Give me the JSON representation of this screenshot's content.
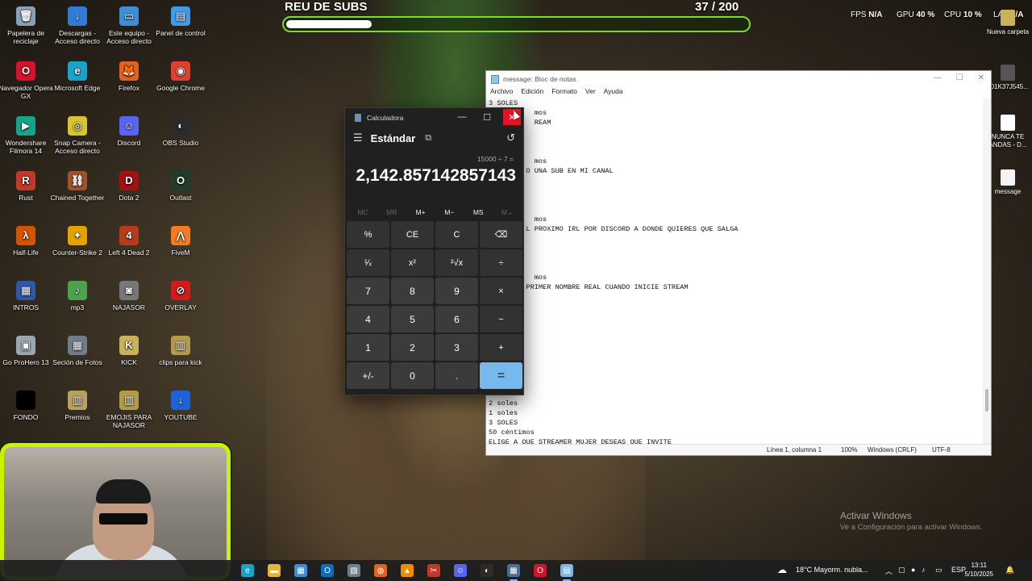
{
  "overlay": {
    "title": "REU DE SUBS",
    "count": "37 / 200",
    "progress": 0.185,
    "stats": {
      "fps_label": "FPS",
      "fps_value": "N/A",
      "gpu_label": "GPU",
      "gpu_value": "40 %",
      "cpu_label": "CPU",
      "cpu_value": "10 %",
      "lat_label": "LAT",
      "lat_value": "N/A"
    }
  },
  "desktop_icons": [
    {
      "label": "Papelera de reciclaje",
      "icon": "recycle-bin-icon",
      "color": "#8aa0b6",
      "glyph": "🗑"
    },
    {
      "label": "Descargas - Acceso directo",
      "icon": "downloads-icon",
      "color": "#2f7bd6",
      "glyph": "↓"
    },
    {
      "label": "Este equipo - Acceso directo",
      "icon": "computer-icon",
      "color": "#3b8fd9",
      "glyph": "▭"
    },
    {
      "label": "Panel de control",
      "icon": "control-panel-icon",
      "color": "#3d9be9",
      "glyph": "▤"
    },
    {
      "label": "Navegador Opera GX",
      "icon": "opera-gx-icon",
      "color": "#d3122b",
      "glyph": "O"
    },
    {
      "label": "Microsoft Edge",
      "icon": "edge-icon",
      "color": "#1aa3c9",
      "glyph": "e"
    },
    {
      "label": "Firefox",
      "icon": "firefox-icon",
      "color": "#e8601c",
      "glyph": "🦊"
    },
    {
      "label": "Google Chrome",
      "icon": "chrome-icon",
      "color": "#e0402f",
      "glyph": "◉"
    },
    {
      "label": "Wondershare Filmora 14",
      "icon": "filmora-icon",
      "color": "#14a58b",
      "glyph": "▶"
    },
    {
      "label": "Snap Camera - Acceso directo",
      "icon": "snap-camera-icon",
      "color": "#d8c62c",
      "glyph": "◎"
    },
    {
      "label": "Discord",
      "icon": "discord-icon",
      "color": "#5865f2",
      "glyph": "☺"
    },
    {
      "label": "OBS Studio",
      "icon": "obs-icon",
      "color": "#2b2b2b",
      "glyph": "◐"
    },
    {
      "label": "Rust",
      "icon": "rust-icon",
      "color": "#c0392b",
      "glyph": "R"
    },
    {
      "label": "Chained Together",
      "icon": "chained-together-icon",
      "color": "#a0522d",
      "glyph": "⛓"
    },
    {
      "label": "Dota 2",
      "icon": "dota2-icon",
      "color": "#a31212",
      "glyph": "D"
    },
    {
      "label": "Outlast",
      "icon": "outlast-icon",
      "color": "#1e3d2a",
      "glyph": "O"
    },
    {
      "label": "Half-Life",
      "icon": "half-life-icon",
      "color": "#d35400",
      "glyph": "λ"
    },
    {
      "label": "Counter-Strike 2",
      "icon": "counter-strike-icon",
      "color": "#e3a300",
      "glyph": "✦"
    },
    {
      "label": "Left 4 Dead 2",
      "icon": "left4dead-icon",
      "color": "#b53b1a",
      "glyph": "4"
    },
    {
      "label": "FiveM",
      "icon": "fivem-icon",
      "color": "#f47b20",
      "glyph": "⋀"
    },
    {
      "label": "INTROS",
      "icon": "folder-icon",
      "color": "#3057a8",
      "glyph": "▦"
    },
    {
      "label": "mp3",
      "icon": "media-icon",
      "color": "#4da34d",
      "glyph": "♪"
    },
    {
      "label": "NAJASOR",
      "icon": "camera-icon",
      "color": "#777777",
      "glyph": "◙"
    },
    {
      "label": "OVERLAY",
      "icon": "overlay-icon",
      "color": "#d11b1b",
      "glyph": "⊘"
    },
    {
      "label": "Go ProHero 13",
      "icon": "gopro-icon",
      "color": "#9aa6b0",
      "glyph": "▣"
    },
    {
      "label": "Seción de Fotos",
      "icon": "photos-icon",
      "color": "#6e7f8a",
      "glyph": "▦"
    },
    {
      "label": "KICK",
      "icon": "kick-icon",
      "color": "#c9b25a",
      "glyph": "K"
    },
    {
      "label": "clips para kick",
      "icon": "clips-folder-icon",
      "color": "#b39b4a",
      "glyph": "▥"
    },
    {
      "label": "FONDO",
      "icon": "fondo-icon",
      "color": "#000000",
      "glyph": ""
    },
    {
      "label": "Premios",
      "icon": "premios-icon",
      "color": "#b8a060",
      "glyph": "▥"
    },
    {
      "label": "EMOJIS PARA NAJASOR",
      "icon": "emojis-folder-icon",
      "color": "#b39b4a",
      "glyph": "▥"
    },
    {
      "label": "YOUTUBE",
      "icon": "youtube-download-icon",
      "color": "#1e63d6",
      "glyph": "↓"
    }
  ],
  "right_icons": [
    {
      "label": "Nueva carpeta",
      "icon": "folder-icon"
    },
    {
      "label": "_01K37J545...",
      "icon": "image-file-icon"
    },
    {
      "label": "NUNCA TE ANDAS - D...",
      "icon": "video-file-icon"
    },
    {
      "label": "message",
      "icon": "text-file-icon"
    }
  ],
  "notepad": {
    "title": "message: Bloc de notas",
    "menu": [
      "Archivo",
      "Edición",
      "Formato",
      "Ver",
      "Ayuda"
    ],
    "lines_top": [
      "3 SOLES",
      "           mos",
      "           REAM",
      "",
      "",
      "",
      "           mos",
      "         O UNA SUB EN MI CANAL",
      "",
      "",
      "",
      "",
      "           mos",
      "         L PROXIMO IRL POR DISCORD A DONDE QUIERES QUE SALGA",
      "",
      "",
      "",
      "",
      "           mos",
      "         PRIMER NOMBRE REAL CUANDO INICIE STREAM"
    ],
    "lines_bottom": [
      "2 soles",
      "1 soles",
      "3 SOLES",
      "50 céntimos",
      "ELIGE A QUE STREAMER MUJER DESEAS QUE INVITE"
    ],
    "status": {
      "position": "Línea 1, columna 1",
      "zoom": "100%",
      "eol": "Windows (CRLF)",
      "encoding": "UTF-8"
    }
  },
  "calculator": {
    "title": "Calculadora",
    "mode": "Estándar",
    "expression": "15000 ÷ 7 =",
    "result": "2,142.857142857143",
    "memory": [
      {
        "label": "MC",
        "enabled": false
      },
      {
        "label": "MR",
        "enabled": false
      },
      {
        "label": "M+",
        "enabled": true
      },
      {
        "label": "M−",
        "enabled": true
      },
      {
        "label": "MS",
        "enabled": true
      },
      {
        "label": "M⌄",
        "enabled": false
      }
    ],
    "keys": [
      {
        "label": "%",
        "kind": "op",
        "name": "percent-key"
      },
      {
        "label": "CE",
        "kind": "op",
        "name": "clear-entry-key"
      },
      {
        "label": "C",
        "kind": "op",
        "name": "clear-key"
      },
      {
        "label": "⌫",
        "kind": "op",
        "name": "backspace-key"
      },
      {
        "label": "¹⁄ₓ",
        "kind": "op",
        "name": "reciprocal-key"
      },
      {
        "label": "x²",
        "kind": "op",
        "name": "square-key"
      },
      {
        "label": "²√x",
        "kind": "op",
        "name": "square-root-key"
      },
      {
        "label": "÷",
        "kind": "op",
        "name": "divide-key"
      },
      {
        "label": "7",
        "kind": "num",
        "name": "digit-7-key"
      },
      {
        "label": "8",
        "kind": "num",
        "name": "digit-8-key"
      },
      {
        "label": "9",
        "kind": "num",
        "name": "digit-9-key"
      },
      {
        "label": "×",
        "kind": "op",
        "name": "multiply-key"
      },
      {
        "label": "4",
        "kind": "num",
        "name": "digit-4-key"
      },
      {
        "label": "5",
        "kind": "num",
        "name": "digit-5-key"
      },
      {
        "label": "6",
        "kind": "num",
        "name": "digit-6-key"
      },
      {
        "label": "−",
        "kind": "op",
        "name": "minus-key"
      },
      {
        "label": "1",
        "kind": "num",
        "name": "digit-1-key"
      },
      {
        "label": "2",
        "kind": "num",
        "name": "digit-2-key"
      },
      {
        "label": "3",
        "kind": "num",
        "name": "digit-3-key"
      },
      {
        "label": "+",
        "kind": "op",
        "name": "plus-key"
      },
      {
        "label": "+/-",
        "kind": "num",
        "name": "negate-key"
      },
      {
        "label": "0",
        "kind": "num",
        "name": "digit-0-key"
      },
      {
        "label": ".",
        "kind": "num",
        "name": "decimal-key"
      },
      {
        "label": "=",
        "kind": "eq",
        "name": "equals-key"
      }
    ]
  },
  "watermark": {
    "line1": "Activar Windows",
    "line2": "Ve a Configuración para activar Windows."
  },
  "taskbar": {
    "apps": [
      {
        "name": "edge-icon",
        "color": "#1aa3c9",
        "glyph": "e",
        "active": false
      },
      {
        "name": "file-explorer-icon",
        "color": "#e8b43a",
        "glyph": "▬",
        "active": false
      },
      {
        "name": "store-icon",
        "color": "#3b8fd9",
        "glyph": "▦",
        "active": false
      },
      {
        "name": "outlook-icon",
        "color": "#0f6cbd",
        "glyph": "O",
        "active": false
      },
      {
        "name": "photos-icon",
        "color": "#6e7f8a",
        "glyph": "▧",
        "active": false
      },
      {
        "name": "firefox-icon",
        "color": "#e8601c",
        "glyph": "◍",
        "active": false
      },
      {
        "name": "vlc-icon",
        "color": "#f08c00",
        "glyph": "▲",
        "active": false
      },
      {
        "name": "snip-icon",
        "color": "#c0392b",
        "glyph": "✂",
        "active": false
      },
      {
        "name": "discord-icon",
        "color": "#5865f2",
        "glyph": "☺",
        "active": false
      },
      {
        "name": "obs-icon",
        "color": "#2b2b2b",
        "glyph": "◐",
        "active": false
      },
      {
        "name": "calculator-icon",
        "color": "#4d6e8f",
        "glyph": "▦",
        "active": true
      },
      {
        "name": "opera-gx-icon",
        "color": "#d3122b",
        "glyph": "O",
        "active": false
      },
      {
        "name": "notepad-icon",
        "color": "#7fb8e6",
        "glyph": "▤",
        "active": true
      }
    ],
    "weather": "18°C  Mayorm. nubla...",
    "language": "ESP",
    "time": "13:11",
    "date": "5/10/2025"
  }
}
